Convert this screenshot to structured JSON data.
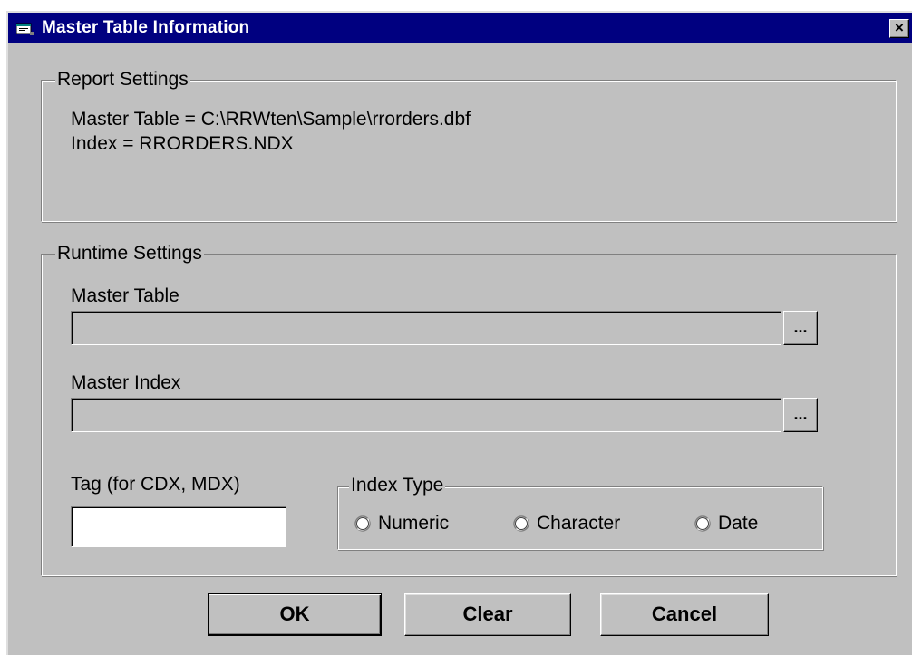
{
  "window": {
    "title": "Master Table Information",
    "close_glyph": "×",
    "icon": "app-window-icon"
  },
  "report_settings": {
    "legend": "Report Settings",
    "master_table_line": "Master Table = C:\\RRWten\\Sample\\rrorders.dbf",
    "index_line": "Index = RRORDERS.NDX"
  },
  "runtime_settings": {
    "legend": "Runtime Settings",
    "master_table": {
      "label": "Master Table",
      "value": "",
      "browse_label": "..."
    },
    "master_index": {
      "label": "Master Index",
      "value": "",
      "browse_label": "..."
    },
    "tag": {
      "label": "Tag (for CDX, MDX)",
      "value": ""
    },
    "index_type": {
      "legend": "Index Type",
      "options": [
        {
          "label": "Numeric",
          "selected": false
        },
        {
          "label": "Character",
          "selected": false
        },
        {
          "label": "Date",
          "selected": false
        }
      ]
    }
  },
  "buttons": {
    "ok": "OK",
    "clear": "Clear",
    "cancel": "Cancel"
  },
  "colors": {
    "titlebar": "#000080",
    "face": "#c0c0c0"
  }
}
